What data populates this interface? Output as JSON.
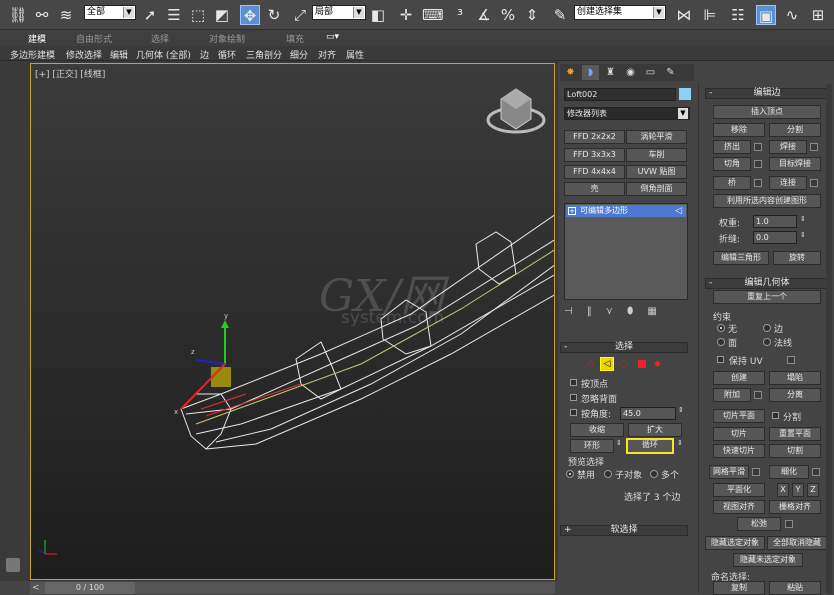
{
  "toolbar": {
    "selection_filter": "全部",
    "ref_coord": "局部",
    "selection_set_placeholder": "创建选择集"
  },
  "ribbon": {
    "tabs": [
      "建模",
      "自由形式",
      "选择",
      "对象绘制",
      "填充"
    ],
    "subitems": [
      "多边形建模",
      "修改选择",
      "编辑",
      "几何体 (全部)",
      "边",
      "循环",
      "三角剖分",
      "细分",
      "对齐",
      "属性"
    ]
  },
  "viewport": {
    "label": "[+] [正交] [线框]",
    "frame_counter": "0 / 100",
    "watermark": "GX/网",
    "watermark_sub": "system.com"
  },
  "cmd": {
    "object_name": "Loft002",
    "modifier_list": "修改器列表",
    "modifier_buttons": [
      "FFD 2x2x2",
      "涡轮平滑",
      "FFD 3x3x3",
      "车削",
      "FFD 4x4x4",
      "UVW 贴图",
      "壳",
      "倒角剖面"
    ],
    "stack_item": "可编辑多边形",
    "selection_title": "选择",
    "by_vertex": "按顶点",
    "ignore_backface": "忽略背面",
    "by_angle": "按角度:",
    "angle_value": "45.0",
    "shrink": "收缩",
    "grow": "扩大",
    "ring": "环形",
    "loop": "循环",
    "preview_title": "预览选择",
    "preview_off": "禁用",
    "preview_sub": "子对象",
    "preview_multi": "多个",
    "selection_status": "选择了 3 个边",
    "soft_selection": "软选择"
  },
  "edit_edges": {
    "title": "编辑边",
    "insert_vertex": "插入顶点",
    "remove": "移除",
    "split": "分割",
    "extrude": "挤出",
    "weld": "焊接",
    "chamfer": "切角",
    "target_weld": "目标焊接",
    "bridge": "桥",
    "connect": "连接",
    "create_shape": "利用所选内容创建图形",
    "weight_label": "权重:",
    "weight_value": "1.0",
    "crease_label": "折缝:",
    "crease_value": "0.0",
    "edit_tri": "编辑三角形",
    "turn": "旋转"
  },
  "edit_geom": {
    "title": "编辑几何体",
    "repeat_last": "重复上一个",
    "constraints": "约束",
    "c_none": "无",
    "c_edge": "边",
    "c_face": "面",
    "c_normal": "法线",
    "preserve_uv": "保持 UV",
    "create": "创建",
    "collapse": "塌陷",
    "attach": "附加",
    "detach": "分离",
    "slice_plane": "切片平面",
    "split": "分割",
    "slice": "切片",
    "reset_plane": "重置平面",
    "quickslice": "快速切片",
    "cut": "切割",
    "meshsmooth": "网格平滑",
    "refine": "细化",
    "planarize": "平面化",
    "x": "X",
    "y": "Y",
    "z": "Z",
    "view_align": "视图对齐",
    "grid_align": "栅格对齐",
    "relax": "松弛",
    "hide_sel": "隐藏选定对象",
    "unhide_all": "全部取消隐藏",
    "hide_unsel": "隐藏未选定对象",
    "named_sel": "命名选择:",
    "copy": "复制",
    "paste": "粘贴"
  }
}
